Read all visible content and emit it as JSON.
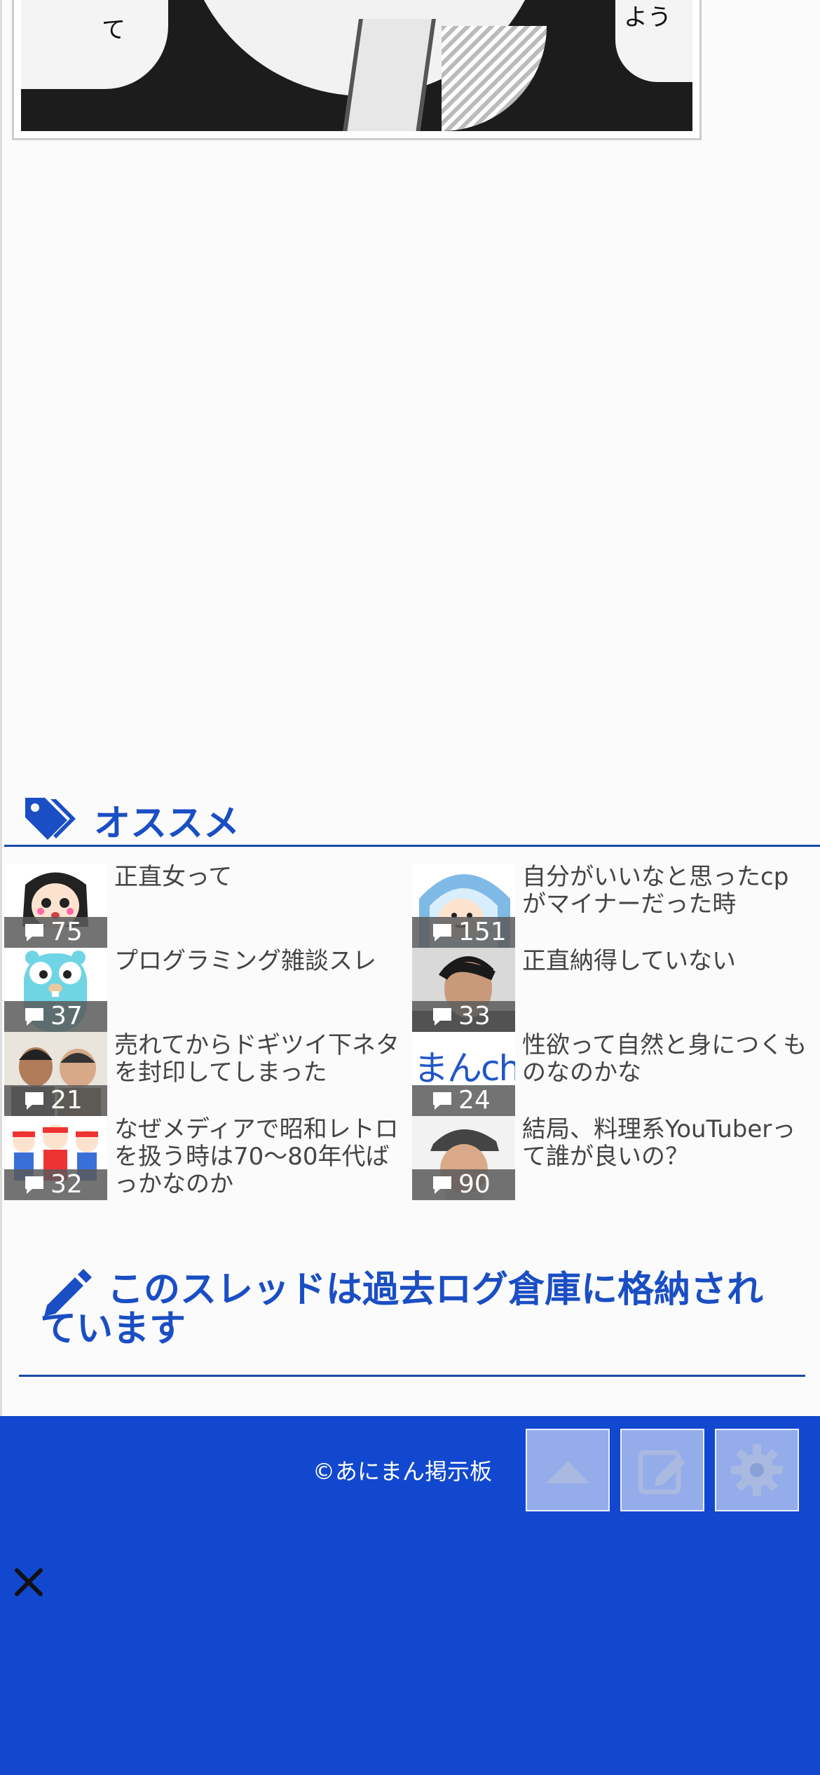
{
  "manga": {
    "left_glyph": "て",
    "right_glyph": "よう"
  },
  "recommend": {
    "title": "オススメ",
    "items": [
      {
        "title": "正直女って",
        "count": "75",
        "thumb": "woman-face"
      },
      {
        "title": "自分がいいなと思ったcpがマイナーだった時",
        "count": "151",
        "thumb": "hood-boy"
      },
      {
        "title": "プログラミング雑談スレ",
        "count": "37",
        "thumb": "gopher"
      },
      {
        "title": "正直納得していない",
        "count": "33",
        "thumb": "man-photo"
      },
      {
        "title": "売れてからドギツイ下ネタを封印してしまった",
        "count": "21",
        "thumb": "comedians"
      },
      {
        "title": "性欲って自然と身につくものなのかな",
        "count": "24",
        "thumb": "manch-logo"
      },
      {
        "title": "なぜメディアで昭和レトロを扱う時は70〜80年代ばっかなのか",
        "count": "32",
        "thumb": "festival-kids"
      },
      {
        "title": "結局、料理系YouTuberって誰が良いの？",
        "count": "90",
        "thumb": "old-man-cap"
      }
    ],
    "logo_text": "まんch"
  },
  "archive": {
    "notice": "このスレッドは過去ログ倉庫に格納されています"
  },
  "footer": {
    "copyright": "©あにまん掲示板",
    "buttons": [
      "scroll-top",
      "compose",
      "settings"
    ]
  },
  "colors": {
    "accent": "#1a4ec4",
    "footer_bg": "#1248cf"
  }
}
